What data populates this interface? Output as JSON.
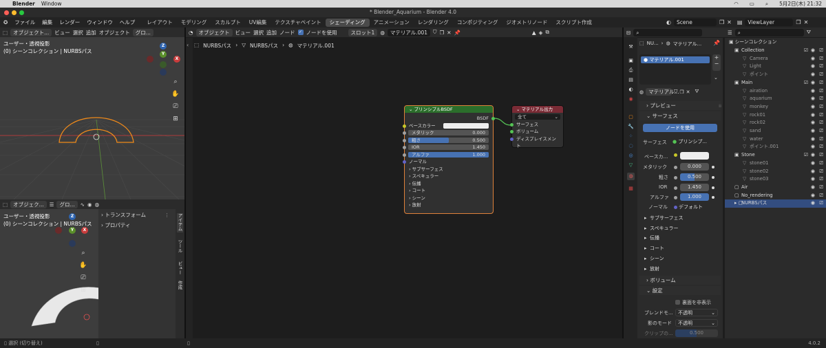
{
  "macbar": {
    "apple": "",
    "app": "Blender",
    "window": "Window",
    "date": "5月2日(木) 21:32"
  },
  "title": "* Blender_Aquarium - Blender 4.0",
  "menus": [
    "ファイル",
    "編集",
    "レンダー",
    "ウィンドウ",
    "ヘルプ"
  ],
  "workspaces": [
    "レイアウト",
    "モデリング",
    "スカルプト",
    "UV編集",
    "テクスチャペイント",
    "シェーディング",
    "アニメーション",
    "レンダリング",
    "コンポジティング",
    "ジオメトリノード",
    "スクリプト作成"
  ],
  "active_workspace": "シェーディング",
  "scene": "Scene",
  "viewlayer": "ViewLayer",
  "viewport_top": {
    "mode": "オブジェクト...",
    "orient": "グロ...",
    "line1": "ユーザー・透視投影",
    "line2": "(0) シーンコレクション | NURBSパス"
  },
  "viewport_bottom": {
    "mode": "オブジェク...",
    "orient": "グロ...",
    "line1": "ユーザー・透視投影",
    "line2": "(0) シーンコレクション | NURBSパス",
    "panel_items": [
      "トランスフォーム",
      "プロパティ"
    ],
    "side_tabs": [
      "アイテム",
      "ツール",
      "ビュー",
      "作成"
    ]
  },
  "gizmo": {
    "z": "Z",
    "y": "Y",
    "x": "X"
  },
  "node_header": {
    "mode": "オブジェクト",
    "menus": [
      "ビュー",
      "選択",
      "追加",
      "ノード"
    ],
    "use_nodes": "ノードを使用",
    "slot": "スロット1",
    "material": "マテリアル.001"
  },
  "breadcrumb": [
    "NURBSパス",
    "NURBSパス",
    "マテリアル.001"
  ],
  "bsdf_node": {
    "title": "プリンシプルBSDF",
    "output": "BSDF",
    "base_color": "ベースカラー",
    "rows": [
      {
        "label": "メタリック",
        "value": "0.000",
        "fill": 0
      },
      {
        "label": "粗さ",
        "value": "0.500",
        "fill": 0.5
      },
      {
        "label": "IOR",
        "value": "1.450",
        "fill": 0
      },
      {
        "label": "アルファ",
        "value": "1.000",
        "fill": 1
      }
    ],
    "normal": "ノーマル",
    "subpanels": [
      "サブサーフェス",
      "スペキュラー",
      "伝播",
      "コート",
      "シーン",
      "放射"
    ]
  },
  "output_node": {
    "title": "マテリアル出力",
    "target": "全て",
    "inputs": [
      "サーフェス",
      "ボリューム",
      "ディスプレイスメント"
    ]
  },
  "props": {
    "object": "NU...",
    "material_crumb": "マテリアル...",
    "slot_item": "マテリアル.001",
    "mat_field": "マテリアル...",
    "preview": "プレビュー",
    "surface": "サーフェス",
    "use_nodes_btn": "ノードを使用",
    "surface_label": "サーフェス",
    "surface_value": "プリンシプ...",
    "base_label": "ベースカ...",
    "fields": [
      {
        "label": "メタリック",
        "value": "0.000",
        "fill": 0
      },
      {
        "label": "粗さ",
        "value": "0.500",
        "fill": 0.5
      },
      {
        "label": "IOR",
        "value": "1.450",
        "fill": 0
      },
      {
        "label": "アルファ",
        "value": "1.000",
        "fill": 1
      }
    ],
    "normal_label": "ノーマル",
    "normal_value": "デフォルト",
    "subpanels": [
      "サブサーフェス",
      "スペキュラー",
      "伝播",
      "コート",
      "シーン",
      "放射"
    ],
    "volume": "ボリューム",
    "settings": "設定",
    "backface": "裏面を非表示",
    "blend_label": "ブレンドモ...",
    "blend_value": "不透明",
    "shadow_label": "影のモード",
    "shadow_value": "不透明",
    "clip_label": "クリップの...",
    "clip_value": "0.500"
  },
  "outliner": {
    "root": "シーンコレクション",
    "items": [
      {
        "name": "Collection",
        "depth": 1,
        "check": true
      },
      {
        "name": "Camera",
        "depth": 2
      },
      {
        "name": "Light",
        "depth": 2
      },
      {
        "name": "ポイント",
        "depth": 2
      },
      {
        "name": "Main",
        "depth": 1,
        "check": true
      },
      {
        "name": "airation",
        "depth": 2
      },
      {
        "name": "aquarium",
        "depth": 2
      },
      {
        "name": "monkey",
        "depth": 2
      },
      {
        "name": "rock01",
        "depth": 2
      },
      {
        "name": "rock02",
        "depth": 2
      },
      {
        "name": "sand",
        "depth": 2
      },
      {
        "name": "water",
        "depth": 2
      },
      {
        "name": "ポイント.001",
        "depth": 2
      },
      {
        "name": "Stone",
        "depth": 1,
        "check": true
      },
      {
        "name": "stone01",
        "depth": 2
      },
      {
        "name": "stone02",
        "depth": 2
      },
      {
        "name": "stone03",
        "depth": 2
      },
      {
        "name": "Air",
        "depth": 1
      },
      {
        "name": "No_rendering",
        "depth": 1
      },
      {
        "name": "NURBSパス",
        "depth": 1,
        "selected": true
      }
    ]
  },
  "status": {
    "left": "選択 (切り替え)",
    "version": "4.0.2"
  },
  "colors": {
    "accent": "#4772b3",
    "node_green": "#2b6e2b",
    "node_red": "#7a2b35",
    "orange": "#f08a1a"
  }
}
